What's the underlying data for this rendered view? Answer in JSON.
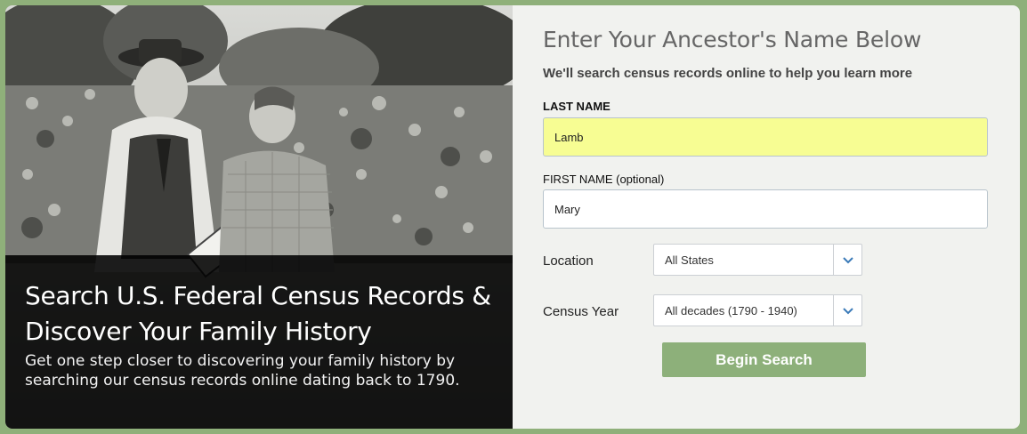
{
  "hero": {
    "title": "Search U.S. Federal Census Records & Discover Your Family History",
    "subtitle": "Get one step closer to discovering your family history by searching our census records online dating back to 1790."
  },
  "form": {
    "heading": "Enter Your Ancestor's Name Below",
    "subheading": "We'll search census records online to help you learn more",
    "last_name": {
      "label": "LAST NAME",
      "value": "Lamb"
    },
    "first_name": {
      "label": "FIRST NAME",
      "label_suffix": "(optional)",
      "value": "Mary"
    },
    "location": {
      "label": "Location",
      "selected": "All States",
      "icon": "chevron-down-icon"
    },
    "census_year": {
      "label": "Census Year",
      "selected": "All decades (1790 - 1940)",
      "icon": "chevron-down-icon"
    },
    "submit_label": "Begin Search"
  },
  "colors": {
    "frame": "#8fb07a",
    "button": "#8db07a",
    "last_name_highlight": "#f7fd93",
    "chevron": "#3a7ab8"
  }
}
